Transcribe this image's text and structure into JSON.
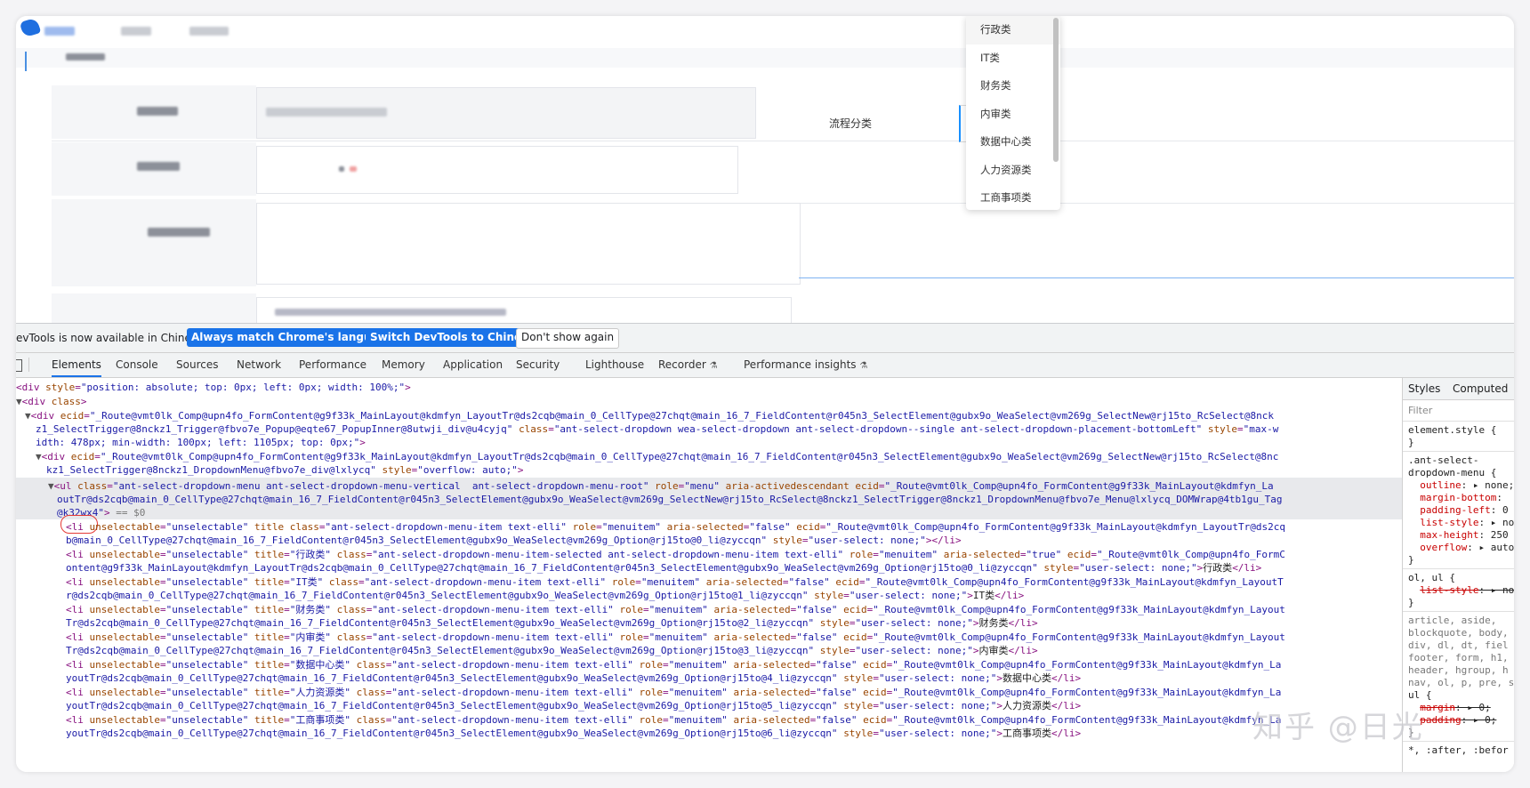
{
  "dropdown": {
    "items": [
      "行政类",
      "IT类",
      "财务类",
      "内审类",
      "数据中心类",
      "人力资源类",
      "工商事项类"
    ],
    "selected_index": 0
  },
  "form": {
    "category_label": "流程分类"
  },
  "devtools": {
    "infobar": {
      "message": "evTools is now available in Chinese!",
      "btn_match": "Always match Chrome's language",
      "btn_switch": "Switch DevTools to Chinese",
      "btn_dismiss": "Don't show again"
    },
    "tabs": [
      "Elements",
      "Console",
      "Sources",
      "Network",
      "Performance",
      "Memory",
      "Application",
      "Security",
      "Lighthouse",
      "Recorder",
      "Performance insights"
    ],
    "active_tab": "Elements",
    "styles_tabs": [
      "Styles",
      "Computed"
    ],
    "styles_filter_placeholder": "Filter"
  },
  "watermark": "知乎 @日光"
}
